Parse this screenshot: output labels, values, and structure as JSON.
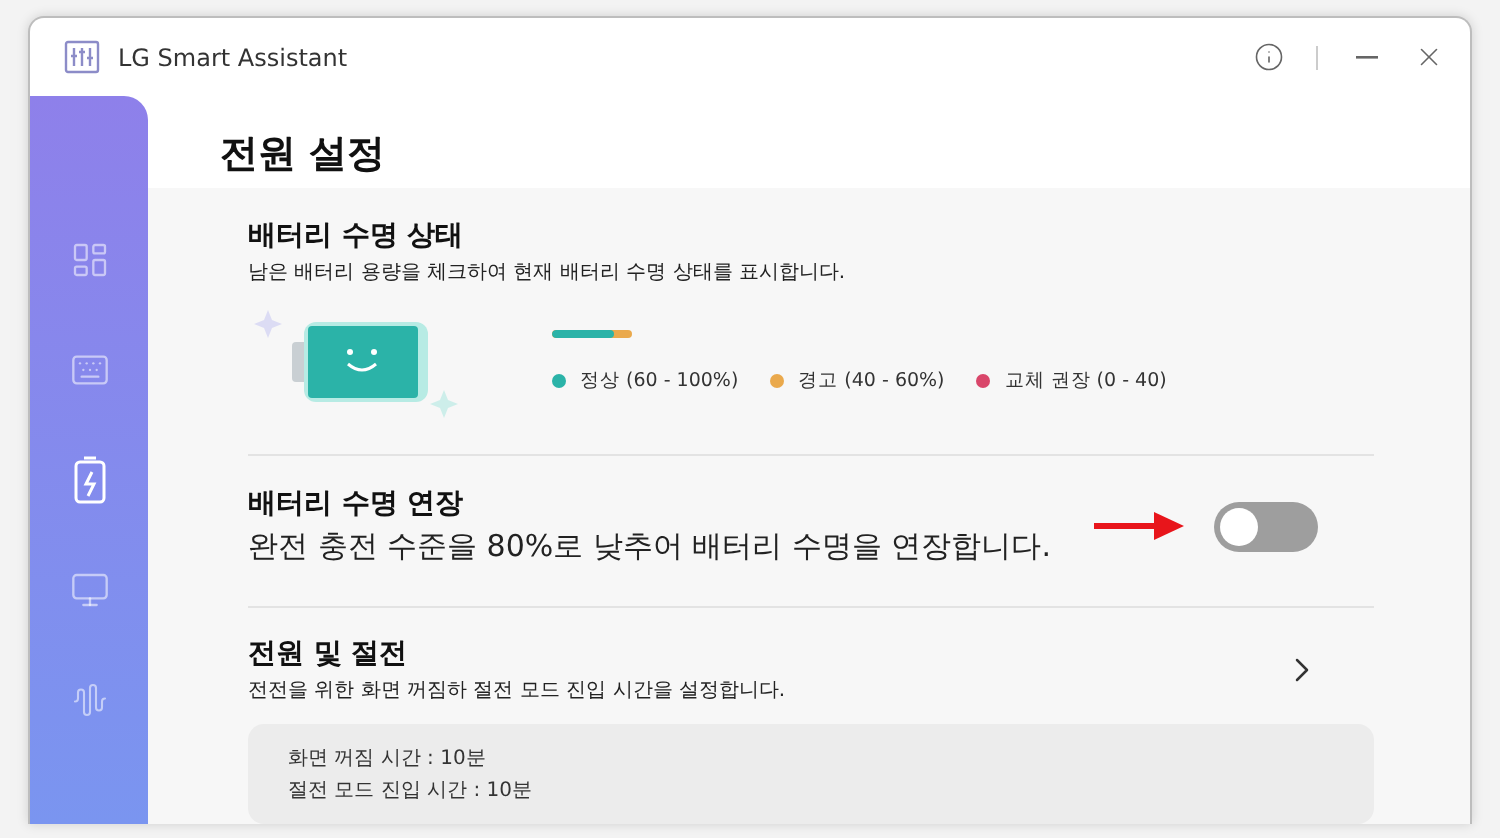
{
  "window": {
    "title": "LG Smart Assistant"
  },
  "sidebar": {
    "items": [
      {
        "kind": "grid",
        "selected": false
      },
      {
        "kind": "keyboard",
        "selected": false
      },
      {
        "kind": "battery",
        "selected": true
      },
      {
        "kind": "monitor",
        "selected": false
      },
      {
        "kind": "waveform",
        "selected": false
      }
    ]
  },
  "page_title": "전원 설정",
  "battery_status": {
    "title": "배터리 수명 상태",
    "description": "남은 배터리 용량을 체크하여 현재 배터리 수명 상태를 표시합니다.",
    "level": 0.78,
    "legend": [
      {
        "label": "정상 (60 - 100%)",
        "color": "#2bb3a8"
      },
      {
        "label": "경고 (40 - 60%)",
        "color": "#eaa94c"
      },
      {
        "label": "교체 권장 (0 - 40)",
        "color": "#d9466a"
      }
    ]
  },
  "battery_extend": {
    "title": "배터리 수명 연장",
    "description": "완전 충전 수준을 80%로 낮추어 배터리 수명을 연장합니다.",
    "on": false
  },
  "power_sleep": {
    "title": "전원 및 절전",
    "description": "전전을 위한 화면 꺼짐하 절전 모드 진입 시간을 설정합니다.",
    "details": [
      "화면 꺼짐 시간 : 10분",
      "절전 모드 진입 시간 : 10분"
    ]
  }
}
